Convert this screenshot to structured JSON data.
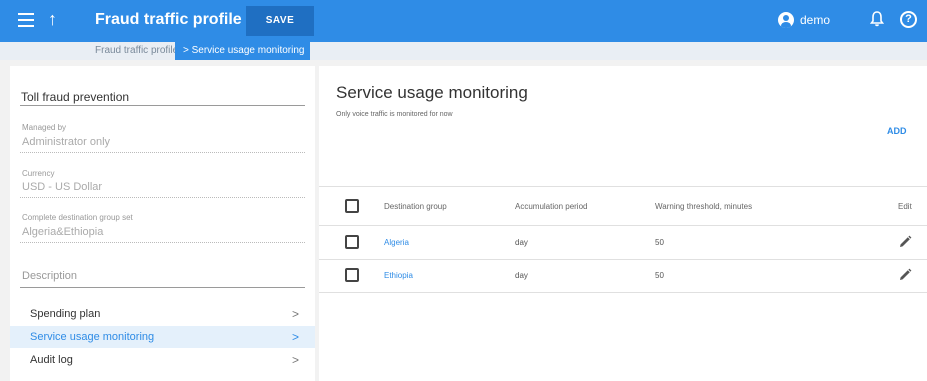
{
  "header": {
    "title": "Fraud traffic profile",
    "save_label": "SAVE",
    "user_name": "demo",
    "help_glyph": "?",
    "up_glyph": "↑",
    "accent": "#2f8ce6"
  },
  "breadcrumb": {
    "parent": "Fraud traffic profile",
    "current": "> Service usage monitoring"
  },
  "left": {
    "name_value": "Toll fraud prevention",
    "managed_by": {
      "label": "Managed by",
      "value": "Administrator only"
    },
    "currency": {
      "label": "Currency",
      "value": "USD - US Dollar"
    },
    "dest_set": {
      "label": "Complete destination group set",
      "value": "Algeria&Ethiopia"
    },
    "description_placeholder": "Description",
    "nav": [
      {
        "label": "Spending plan",
        "chevron": ">"
      },
      {
        "label": "Service usage monitoring",
        "chevron": ">"
      },
      {
        "label": "Audit log",
        "chevron": ">"
      }
    ]
  },
  "main": {
    "title": "Service usage monitoring",
    "subtitle": "Only voice traffic is monitored for now",
    "add_label": "ADD",
    "columns": [
      "Destination group",
      "Accumulation period",
      "Warning threshold, minutes",
      "Edit"
    ],
    "rows": [
      {
        "group": "Algeria",
        "period": "day",
        "threshold": "50"
      },
      {
        "group": "Ethiopia",
        "period": "day",
        "threshold": "50"
      }
    ]
  }
}
